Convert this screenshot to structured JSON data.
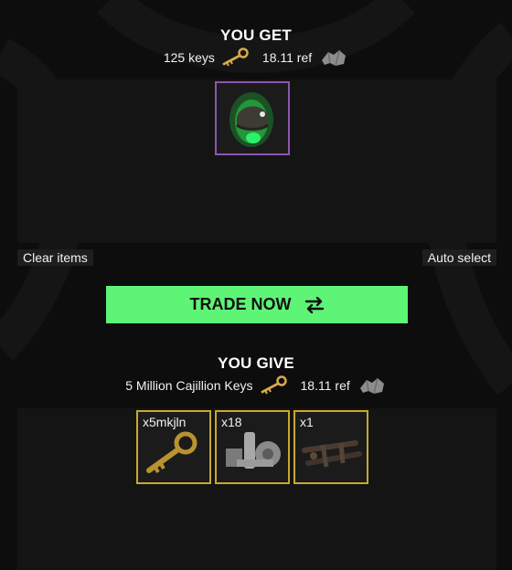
{
  "you_get": {
    "title": "YOU GET",
    "keys_text": "125 keys",
    "ref_text": "18.11 ref",
    "items": [
      {
        "name": "unusual-helmet",
        "quantity": ""
      }
    ]
  },
  "controls": {
    "clear_label": "Clear items",
    "auto_label": "Auto select",
    "trade_label": "TRADE NOW"
  },
  "you_give": {
    "title": "YOU GIVE",
    "keys_text": "5 Million Cajillion Keys",
    "ref_text": "18.11 ref",
    "items": [
      {
        "name": "key",
        "quantity": "x5mkjln"
      },
      {
        "name": "refined-metal-gears",
        "quantity": "x18"
      },
      {
        "name": "scrap-parts",
        "quantity": "x1"
      }
    ]
  },
  "colors": {
    "trade_button": "#5ef476",
    "unique_border": "#c9a82c",
    "unusual_border": "#8b55b0",
    "panel": "#141414"
  }
}
